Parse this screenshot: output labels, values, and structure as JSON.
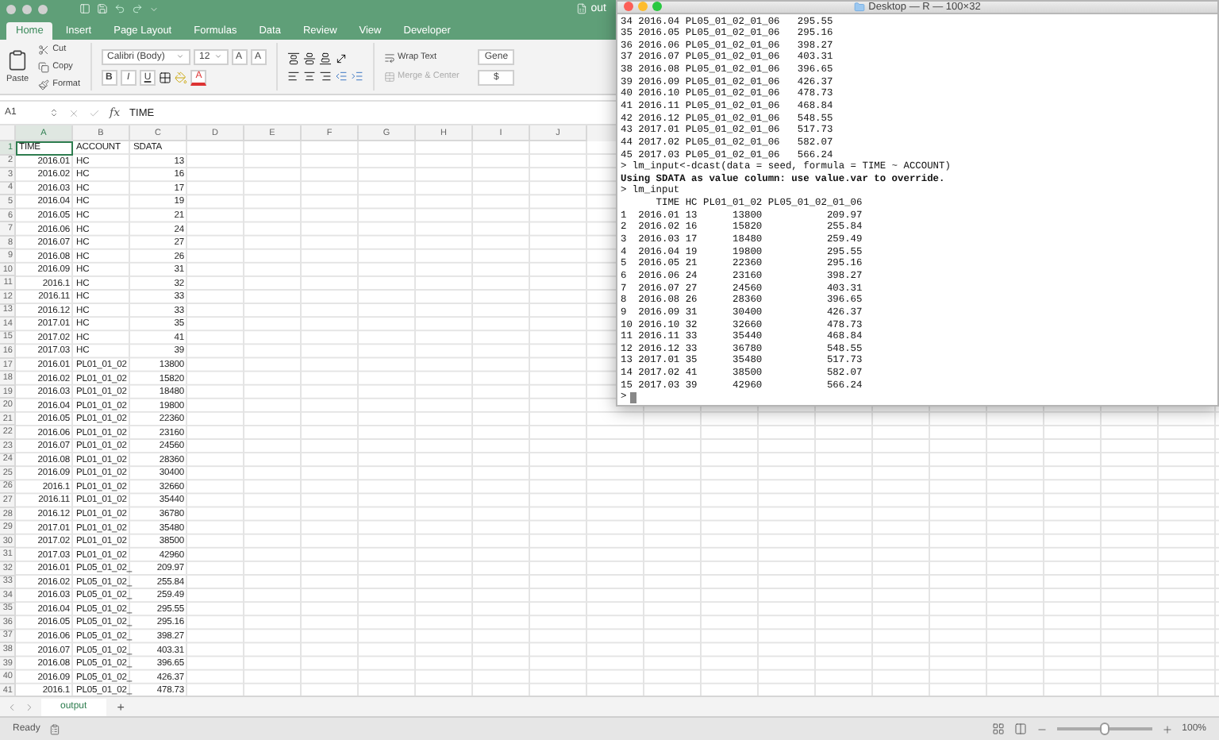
{
  "excel": {
    "title": "out",
    "tabs": [
      {
        "label": "Home",
        "selected": true
      },
      {
        "label": "Insert",
        "selected": false
      },
      {
        "label": "Page Layout",
        "selected": false
      },
      {
        "label": "Formulas",
        "selected": false
      },
      {
        "label": "Data",
        "selected": false
      },
      {
        "label": "Review",
        "selected": false
      },
      {
        "label": "View",
        "selected": false
      },
      {
        "label": "Developer",
        "selected": false
      }
    ],
    "ribbon": {
      "paste": "Paste",
      "cut": "Cut",
      "copy": "Copy",
      "format": "Format",
      "font_name": "Calibri (Body)",
      "font_size": "12",
      "grow_font": "A",
      "shrink_font": "A",
      "bold": "B",
      "italic": "I",
      "underline": "U",
      "font_color": "A",
      "wrap_text": "Wrap Text",
      "merge_center": "Merge & Center",
      "number_format": "Gene",
      "currency": "$"
    },
    "formula_bar": {
      "cell": "A1",
      "fx": "fx",
      "value": "TIME"
    },
    "columns": [
      {
        "label": "A",
        "selected": true
      },
      {
        "label": "B",
        "selected": false
      },
      {
        "label": "C",
        "selected": false
      },
      {
        "label": "D",
        "selected": false
      },
      {
        "label": "E",
        "selected": false
      },
      {
        "label": "F",
        "selected": false
      },
      {
        "label": "G",
        "selected": false
      },
      {
        "label": "H",
        "selected": false
      },
      {
        "label": "I",
        "selected": false
      },
      {
        "label": "J",
        "selected": false
      }
    ],
    "rows": [
      {
        "number": "1",
        "selected": true,
        "cells": [
          "TIME",
          "ACCOUNT",
          "SDATA"
        ]
      },
      {
        "number": "2",
        "selected": false,
        "cells": [
          "2016.01",
          "HC",
          "13"
        ]
      },
      {
        "number": "3",
        "selected": false,
        "cells": [
          "2016.02",
          "HC",
          "16"
        ]
      },
      {
        "number": "4",
        "selected": false,
        "cells": [
          "2016.03",
          "HC",
          "17"
        ]
      },
      {
        "number": "5",
        "selected": false,
        "cells": [
          "2016.04",
          "HC",
          "19"
        ]
      },
      {
        "number": "6",
        "selected": false,
        "cells": [
          "2016.05",
          "HC",
          "21"
        ]
      },
      {
        "number": "7",
        "selected": false,
        "cells": [
          "2016.06",
          "HC",
          "24"
        ]
      },
      {
        "number": "8",
        "selected": false,
        "cells": [
          "2016.07",
          "HC",
          "27"
        ]
      },
      {
        "number": "9",
        "selected": false,
        "cells": [
          "2016.08",
          "HC",
          "26"
        ]
      },
      {
        "number": "10",
        "selected": false,
        "cells": [
          "2016.09",
          "HC",
          "31"
        ]
      },
      {
        "number": "11",
        "selected": false,
        "cells": [
          "2016.1",
          "HC",
          "32"
        ]
      },
      {
        "number": "12",
        "selected": false,
        "cells": [
          "2016.11",
          "HC",
          "33"
        ]
      },
      {
        "number": "13",
        "selected": false,
        "cells": [
          "2016.12",
          "HC",
          "33"
        ]
      },
      {
        "number": "14",
        "selected": false,
        "cells": [
          "2017.01",
          "HC",
          "35"
        ]
      },
      {
        "number": "15",
        "selected": false,
        "cells": [
          "2017.02",
          "HC",
          "41"
        ]
      },
      {
        "number": "16",
        "selected": false,
        "cells": [
          "2017.03",
          "HC",
          "39"
        ]
      },
      {
        "number": "17",
        "selected": false,
        "cells": [
          "2016.01",
          "PL01_01_02",
          "13800"
        ]
      },
      {
        "number": "18",
        "selected": false,
        "cells": [
          "2016.02",
          "PL01_01_02",
          "15820"
        ]
      },
      {
        "number": "19",
        "selected": false,
        "cells": [
          "2016.03",
          "PL01_01_02",
          "18480"
        ]
      },
      {
        "number": "20",
        "selected": false,
        "cells": [
          "2016.04",
          "PL01_01_02",
          "19800"
        ]
      },
      {
        "number": "21",
        "selected": false,
        "cells": [
          "2016.05",
          "PL01_01_02",
          "22360"
        ]
      },
      {
        "number": "22",
        "selected": false,
        "cells": [
          "2016.06",
          "PL01_01_02",
          "23160"
        ]
      },
      {
        "number": "23",
        "selected": false,
        "cells": [
          "2016.07",
          "PL01_01_02",
          "24560"
        ]
      },
      {
        "number": "24",
        "selected": false,
        "cells": [
          "2016.08",
          "PL01_01_02",
          "28360"
        ]
      },
      {
        "number": "25",
        "selected": false,
        "cells": [
          "2016.09",
          "PL01_01_02",
          "30400"
        ]
      },
      {
        "number": "26",
        "selected": false,
        "cells": [
          "2016.1",
          "PL01_01_02",
          "32660"
        ]
      },
      {
        "number": "27",
        "selected": false,
        "cells": [
          "2016.11",
          "PL01_01_02",
          "35440"
        ]
      },
      {
        "number": "28",
        "selected": false,
        "cells": [
          "2016.12",
          "PL01_01_02",
          "36780"
        ]
      },
      {
        "number": "29",
        "selected": false,
        "cells": [
          "2017.01",
          "PL01_01_02",
          "35480"
        ]
      },
      {
        "number": "30",
        "selected": false,
        "cells": [
          "2017.02",
          "PL01_01_02",
          "38500"
        ]
      },
      {
        "number": "31",
        "selected": false,
        "cells": [
          "2017.03",
          "PL01_01_02",
          "42960"
        ]
      },
      {
        "number": "32",
        "selected": false,
        "cells": [
          "2016.01",
          "PL05_01_02_",
          "209.97"
        ]
      },
      {
        "number": "33",
        "selected": false,
        "cells": [
          "2016.02",
          "PL05_01_02_",
          "255.84"
        ]
      },
      {
        "number": "34",
        "selected": false,
        "cells": [
          "2016.03",
          "PL05_01_02_",
          "259.49"
        ]
      },
      {
        "number": "35",
        "selected": false,
        "cells": [
          "2016.04",
          "PL05_01_02_",
          "295.55"
        ]
      },
      {
        "number": "36",
        "selected": false,
        "cells": [
          "2016.05",
          "PL05_01_02_",
          "295.16"
        ]
      },
      {
        "number": "37",
        "selected": false,
        "cells": [
          "2016.06",
          "PL05_01_02_",
          "398.27"
        ]
      },
      {
        "number": "38",
        "selected": false,
        "cells": [
          "2016.07",
          "PL05_01_02_",
          "403.31"
        ]
      },
      {
        "number": "39",
        "selected": false,
        "cells": [
          "2016.08",
          "PL05_01_02_",
          "396.65"
        ]
      },
      {
        "number": "40",
        "selected": false,
        "cells": [
          "2016.09",
          "PL05_01_02_",
          "426.37"
        ]
      },
      {
        "number": "41",
        "selected": false,
        "cells": [
          "2016.1",
          "PL05_01_02_",
          "478.73"
        ]
      }
    ],
    "sheet_tabs": [
      {
        "label": "output",
        "selected": true
      }
    ],
    "add_sheet": "+",
    "status": "Ready",
    "zoom": {
      "level": 0.5,
      "reading": "100%"
    }
  },
  "terminal": {
    "title": "Desktop — R — 100×32",
    "lines": [
      {
        "kind": "output",
        "text": "34 2016.04 PL05_01_02_01_06   295.55"
      },
      {
        "kind": "output",
        "text": "35 2016.05 PL05_01_02_01_06   295.16"
      },
      {
        "kind": "output",
        "text": "36 2016.06 PL05_01_02_01_06   398.27"
      },
      {
        "kind": "output",
        "text": "37 2016.07 PL05_01_02_01_06   403.31"
      },
      {
        "kind": "output",
        "text": "38 2016.08 PL05_01_02_01_06   396.65"
      },
      {
        "kind": "output",
        "text": "39 2016.09 PL05_01_02_01_06   426.37"
      },
      {
        "kind": "output",
        "text": "40 2016.10 PL05_01_02_01_06   478.73"
      },
      {
        "kind": "output",
        "text": "41 2016.11 PL05_01_02_01_06   468.84"
      },
      {
        "kind": "output",
        "text": "42 2016.12 PL05_01_02_01_06   548.55"
      },
      {
        "kind": "output",
        "text": "43 2017.01 PL05_01_02_01_06   517.73"
      },
      {
        "kind": "output",
        "text": "44 2017.02 PL05_01_02_01_06   582.07"
      },
      {
        "kind": "output",
        "text": "45 2017.03 PL05_01_02_01_06   566.24"
      },
      {
        "kind": "command",
        "text": "> lm_input<-dcast(data = seed, formula = TIME ~ ACCOUNT)"
      },
      {
        "kind": "message",
        "text": "Using SDATA as value column: use value.var to override."
      },
      {
        "kind": "command",
        "text": "> lm_input"
      },
      {
        "kind": "output",
        "text": "      TIME HC PL01_01_02 PL05_01_02_01_06"
      },
      {
        "kind": "output",
        "text": "1  2016.01 13      13800           209.97"
      },
      {
        "kind": "output",
        "text": "2  2016.02 16      15820           255.84"
      },
      {
        "kind": "output",
        "text": "3  2016.03 17      18480           259.49"
      },
      {
        "kind": "output",
        "text": "4  2016.04 19      19800           295.55"
      },
      {
        "kind": "output",
        "text": "5  2016.05 21      22360           295.16"
      },
      {
        "kind": "output",
        "text": "6  2016.06 24      23160           398.27"
      },
      {
        "kind": "output",
        "text": "7  2016.07 27      24560           403.31"
      },
      {
        "kind": "output",
        "text": "8  2016.08 26      28360           396.65"
      },
      {
        "kind": "output",
        "text": "9  2016.09 31      30400           426.37"
      },
      {
        "kind": "output",
        "text": "10 2016.10 32      32660           478.73"
      },
      {
        "kind": "output",
        "text": "11 2016.11 33      35440           468.84"
      },
      {
        "kind": "output",
        "text": "12 2016.12 33      36780           548.55"
      },
      {
        "kind": "output",
        "text": "13 2017.01 35      35480           517.73"
      },
      {
        "kind": "output",
        "text": "14 2017.02 41      38500           582.07"
      },
      {
        "kind": "output",
        "text": "15 2017.03 39      42960           566.24"
      },
      {
        "kind": "prompt",
        "text": ">"
      }
    ]
  }
}
